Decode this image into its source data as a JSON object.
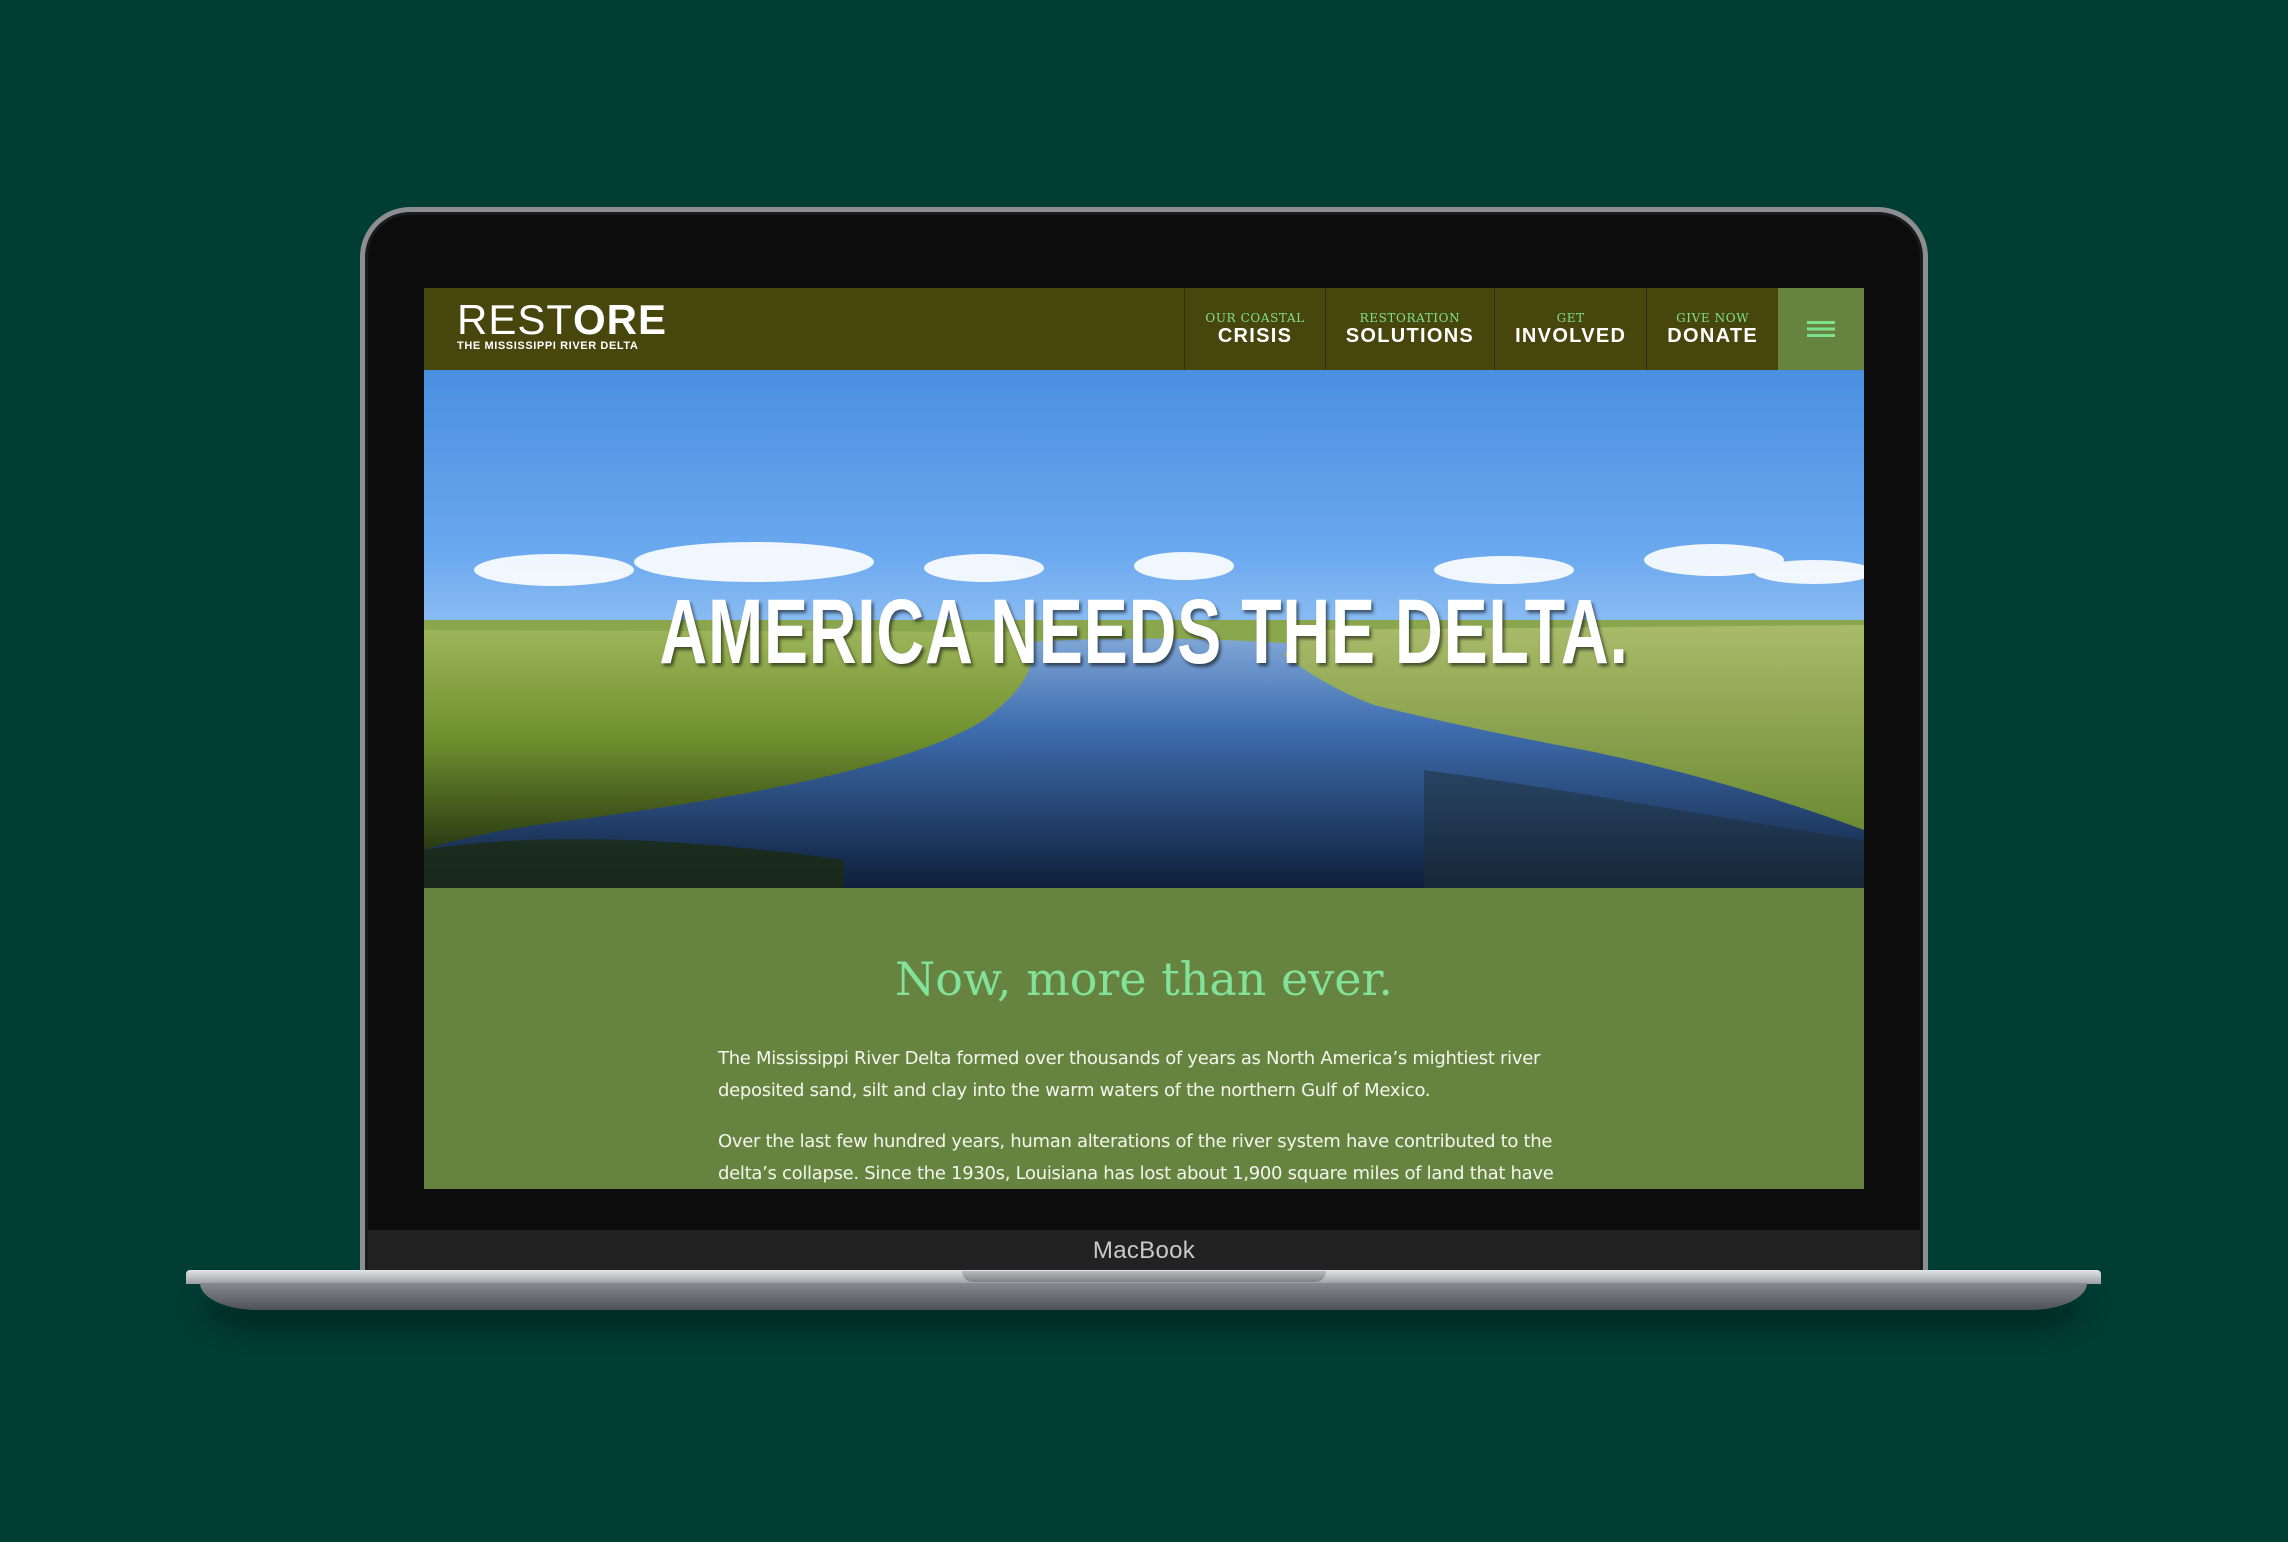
{
  "device": {
    "brand_label": "MacBook"
  },
  "header": {
    "logo_main_thin": "REST",
    "logo_main_bold": "ORE",
    "logo_sub": "THE MISSISSIPPI RIVER DELTA",
    "nav": [
      {
        "kicker": "OUR COASTAL",
        "label": "CRISIS"
      },
      {
        "kicker": "RESTORATION",
        "label": "SOLUTIONS"
      },
      {
        "kicker": "GET",
        "label": "INVOLVED"
      },
      {
        "kicker": "GIVE NOW",
        "label": "DONATE"
      }
    ],
    "menu_icon": "hamburger-icon"
  },
  "hero": {
    "title": "AMERICA NEEDS THE DELTA."
  },
  "content": {
    "heading": "Now, more than ever.",
    "paragraph_1": "The Mississippi River Delta formed over thousands of years as North America’s mightiest river deposited sand, silt and clay into the warm waters of the northern Gulf of Mexico.",
    "paragraph_2": "Over the last few hundred years, human alterations of the river system have contributed to the delta’s collapse. Since the 1930s, Louisiana has lost about 1,900 square miles of land that have disappeared into open water. Recent catastrophes, such as Hurricanes Katrina and Rita, and the BP oil disaster, exacerbated"
  },
  "colors": {
    "page_background": "#003d33",
    "header_background": "#47460d",
    "accent_green": "#66843f",
    "kicker_green": "#7fe08c",
    "heading_green": "#82e19a"
  }
}
